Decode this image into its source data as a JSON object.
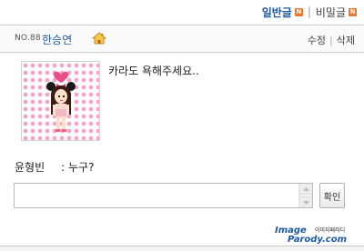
{
  "tabs": [
    {
      "label": "일반글",
      "badge": "N",
      "active": true
    },
    {
      "label": "비밀글",
      "badge": "N",
      "active": false
    }
  ],
  "tab_separator": "|",
  "post": {
    "number_label": "NO.88",
    "author": "한승연",
    "edit_label": "수정",
    "delete_label": "삭제",
    "action_separator": "|",
    "content": "카라도 욕해주세요.."
  },
  "comment": {
    "author": "윤형빈",
    "text": ": 누구?"
  },
  "comment_form": {
    "input_value": "",
    "submit_label": "확인"
  },
  "watermark": {
    "text_main": "ImageParody.com",
    "text_korean": "이미지패러디"
  },
  "colors": {
    "accent": "#1e5a9c",
    "badge": "#e8762b",
    "border": "#c9c9c9"
  },
  "icons": [
    "n-badge-icon",
    "home-icon",
    "scroll-up-icon",
    "scroll-down-icon"
  ]
}
